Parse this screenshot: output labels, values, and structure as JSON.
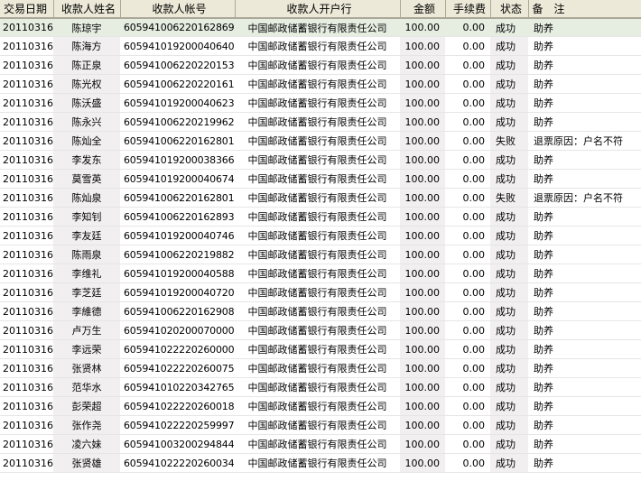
{
  "headers": [
    "交易日期",
    "收款人姓名",
    "收款人帐号",
    "收款人开户行",
    "金额",
    "手续费",
    "状态",
    "备　注"
  ],
  "rows": [
    [
      "20110316",
      "陈琼宇",
      "605941006220162869",
      "中国邮政储蓄银行有限责任公司",
      "100.00",
      "0.00",
      "成功",
      "助养"
    ],
    [
      "20110316",
      "陈海方",
      "605941019200040640",
      "中国邮政储蓄银行有限责任公司",
      "100.00",
      "0.00",
      "成功",
      "助养"
    ],
    [
      "20110316",
      "陈正泉",
      "605941006220220153",
      "中国邮政储蓄银行有限责任公司",
      "100.00",
      "0.00",
      "成功",
      "助养"
    ],
    [
      "20110316",
      "陈光权",
      "605941006220220161",
      "中国邮政储蓄银行有限责任公司",
      "100.00",
      "0.00",
      "成功",
      "助养"
    ],
    [
      "20110316",
      "陈沃盛",
      "605941019200040623",
      "中国邮政储蓄银行有限责任公司",
      "100.00",
      "0.00",
      "成功",
      "助养"
    ],
    [
      "20110316",
      "陈永兴",
      "605941006220219962",
      "中国邮政储蓄银行有限责任公司",
      "100.00",
      "0.00",
      "成功",
      "助养"
    ],
    [
      "20110316",
      "陈灿全",
      "605941006220162801",
      "中国邮政储蓄银行有限责任公司",
      "100.00",
      "0.00",
      "失败",
      "退票原因：户名不符"
    ],
    [
      "20110316",
      "李发东",
      "605941019200038366",
      "中国邮政储蓄银行有限责任公司",
      "100.00",
      "0.00",
      "成功",
      "助养"
    ],
    [
      "20110316",
      "莫雪英",
      "605941019200040674",
      "中国邮政储蓄银行有限责任公司",
      "100.00",
      "0.00",
      "成功",
      "助养"
    ],
    [
      "20110316",
      "陈灿泉",
      "605941006220162801",
      "中国邮政储蓄银行有限责任公司",
      "100.00",
      "0.00",
      "失败",
      "退票原因：户名不符"
    ],
    [
      "20110316",
      "李知钊",
      "605941006220162893",
      "中国邮政储蓄银行有限责任公司",
      "100.00",
      "0.00",
      "成功",
      "助养"
    ],
    [
      "20110316",
      "李友廷",
      "605941019200040746",
      "中国邮政储蓄银行有限责任公司",
      "100.00",
      "0.00",
      "成功",
      "助养"
    ],
    [
      "20110316",
      "陈雨泉",
      "605941006220219882",
      "中国邮政储蓄银行有限责任公司",
      "100.00",
      "0.00",
      "成功",
      "助养"
    ],
    [
      "20110316",
      "李维礼",
      "605941019200040588",
      "中国邮政储蓄银行有限责任公司",
      "100.00",
      "0.00",
      "成功",
      "助养"
    ],
    [
      "20110316",
      "李芝廷",
      "605941019200040720",
      "中国邮政储蓄银行有限责任公司",
      "100.00",
      "0.00",
      "成功",
      "助养"
    ],
    [
      "20110316",
      "李維德",
      "605941006220162908",
      "中国邮政储蓄银行有限责任公司",
      "100.00",
      "0.00",
      "成功",
      "助养"
    ],
    [
      "20110316",
      "卢万生",
      "605941020200070000",
      "中国邮政储蓄银行有限责任公司",
      "100.00",
      "0.00",
      "成功",
      "助养"
    ],
    [
      "20110316",
      "李远荣",
      "605941022220260000",
      "中国邮政储蓄银行有限责任公司",
      "100.00",
      "0.00",
      "成功",
      "助养"
    ],
    [
      "20110316",
      "张贤林",
      "605941022220260075",
      "中国邮政储蓄银行有限责任公司",
      "100.00",
      "0.00",
      "成功",
      "助养"
    ],
    [
      "20110316",
      "范华水",
      "605941010220342765",
      "中国邮政储蓄银行有限责任公司",
      "100.00",
      "0.00",
      "成功",
      "助养"
    ],
    [
      "20110316",
      "彭荣超",
      "605941022220260018",
      "中国邮政储蓄银行有限责任公司",
      "100.00",
      "0.00",
      "成功",
      "助养"
    ],
    [
      "20110316",
      "张作尧",
      "605941022220259997",
      "中国邮政储蓄银行有限责任公司",
      "100.00",
      "0.00",
      "成功",
      "助养"
    ],
    [
      "20110316",
      "凌六妹",
      "605941003200294844",
      "中国邮政储蓄银行有限责任公司",
      "100.00",
      "0.00",
      "成功",
      "助养"
    ],
    [
      "20110316",
      "张贤雄",
      "605941022220260034",
      "中国邮政储蓄银行有限责任公司",
      "100.00",
      "0.00",
      "成功",
      "助养"
    ]
  ]
}
